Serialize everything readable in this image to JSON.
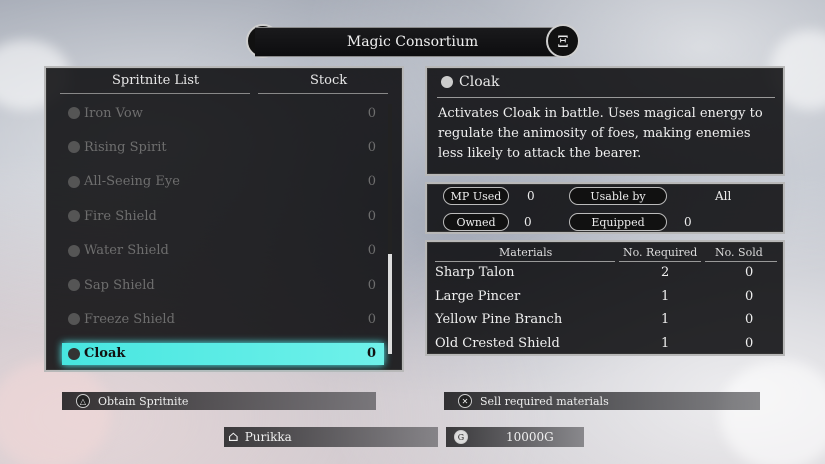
{
  "header": {
    "title": "Magic Consortium",
    "emblem_glyph": "Ξ"
  },
  "list": {
    "col_name": "Spritnite List",
    "col_stock": "Stock",
    "items": [
      {
        "name": "Iron Vow",
        "stock": "0"
      },
      {
        "name": "Rising Spirit",
        "stock": "0"
      },
      {
        "name": "All-Seeing Eye",
        "stock": "0"
      },
      {
        "name": "Fire Shield",
        "stock": "0"
      },
      {
        "name": "Water Shield",
        "stock": "0"
      },
      {
        "name": "Sap Shield",
        "stock": "0"
      },
      {
        "name": "Freeze Shield",
        "stock": "0"
      },
      {
        "name": "Cloak",
        "stock": "0"
      }
    ],
    "selected_index": 7
  },
  "detail": {
    "name": "Cloak",
    "description": "Activates Cloak in battle. Uses magical energy to regulate the animosity of foes, making enemies less likely to attack the bearer.",
    "mp_used_label": "MP Used",
    "mp_used": "0",
    "usable_by_label": "Usable by",
    "usable_by": "All",
    "owned_label": "Owned",
    "owned": "0",
    "equipped_label": "Equipped",
    "equipped": "0"
  },
  "materials": {
    "col_material": "Materials",
    "col_required": "No. Required",
    "col_sold": "No. Sold",
    "rows": [
      {
        "name": "Sharp Talon",
        "required": "2",
        "sold": "0"
      },
      {
        "name": "Large Pincer",
        "required": "1",
        "sold": "0"
      },
      {
        "name": "Yellow Pine Branch",
        "required": "1",
        "sold": "0"
      },
      {
        "name": "Old Crested Shield",
        "required": "1",
        "sold": "0"
      }
    ]
  },
  "footer": {
    "obtain_label": "Obtain Spritnite",
    "obtain_button": "△",
    "sell_label": "Sell required materials",
    "sell_button": "✕",
    "location": "Purikka",
    "gold_icon": "G",
    "gold": "10000G"
  },
  "colors": {
    "highlight": "#5eeee6"
  }
}
